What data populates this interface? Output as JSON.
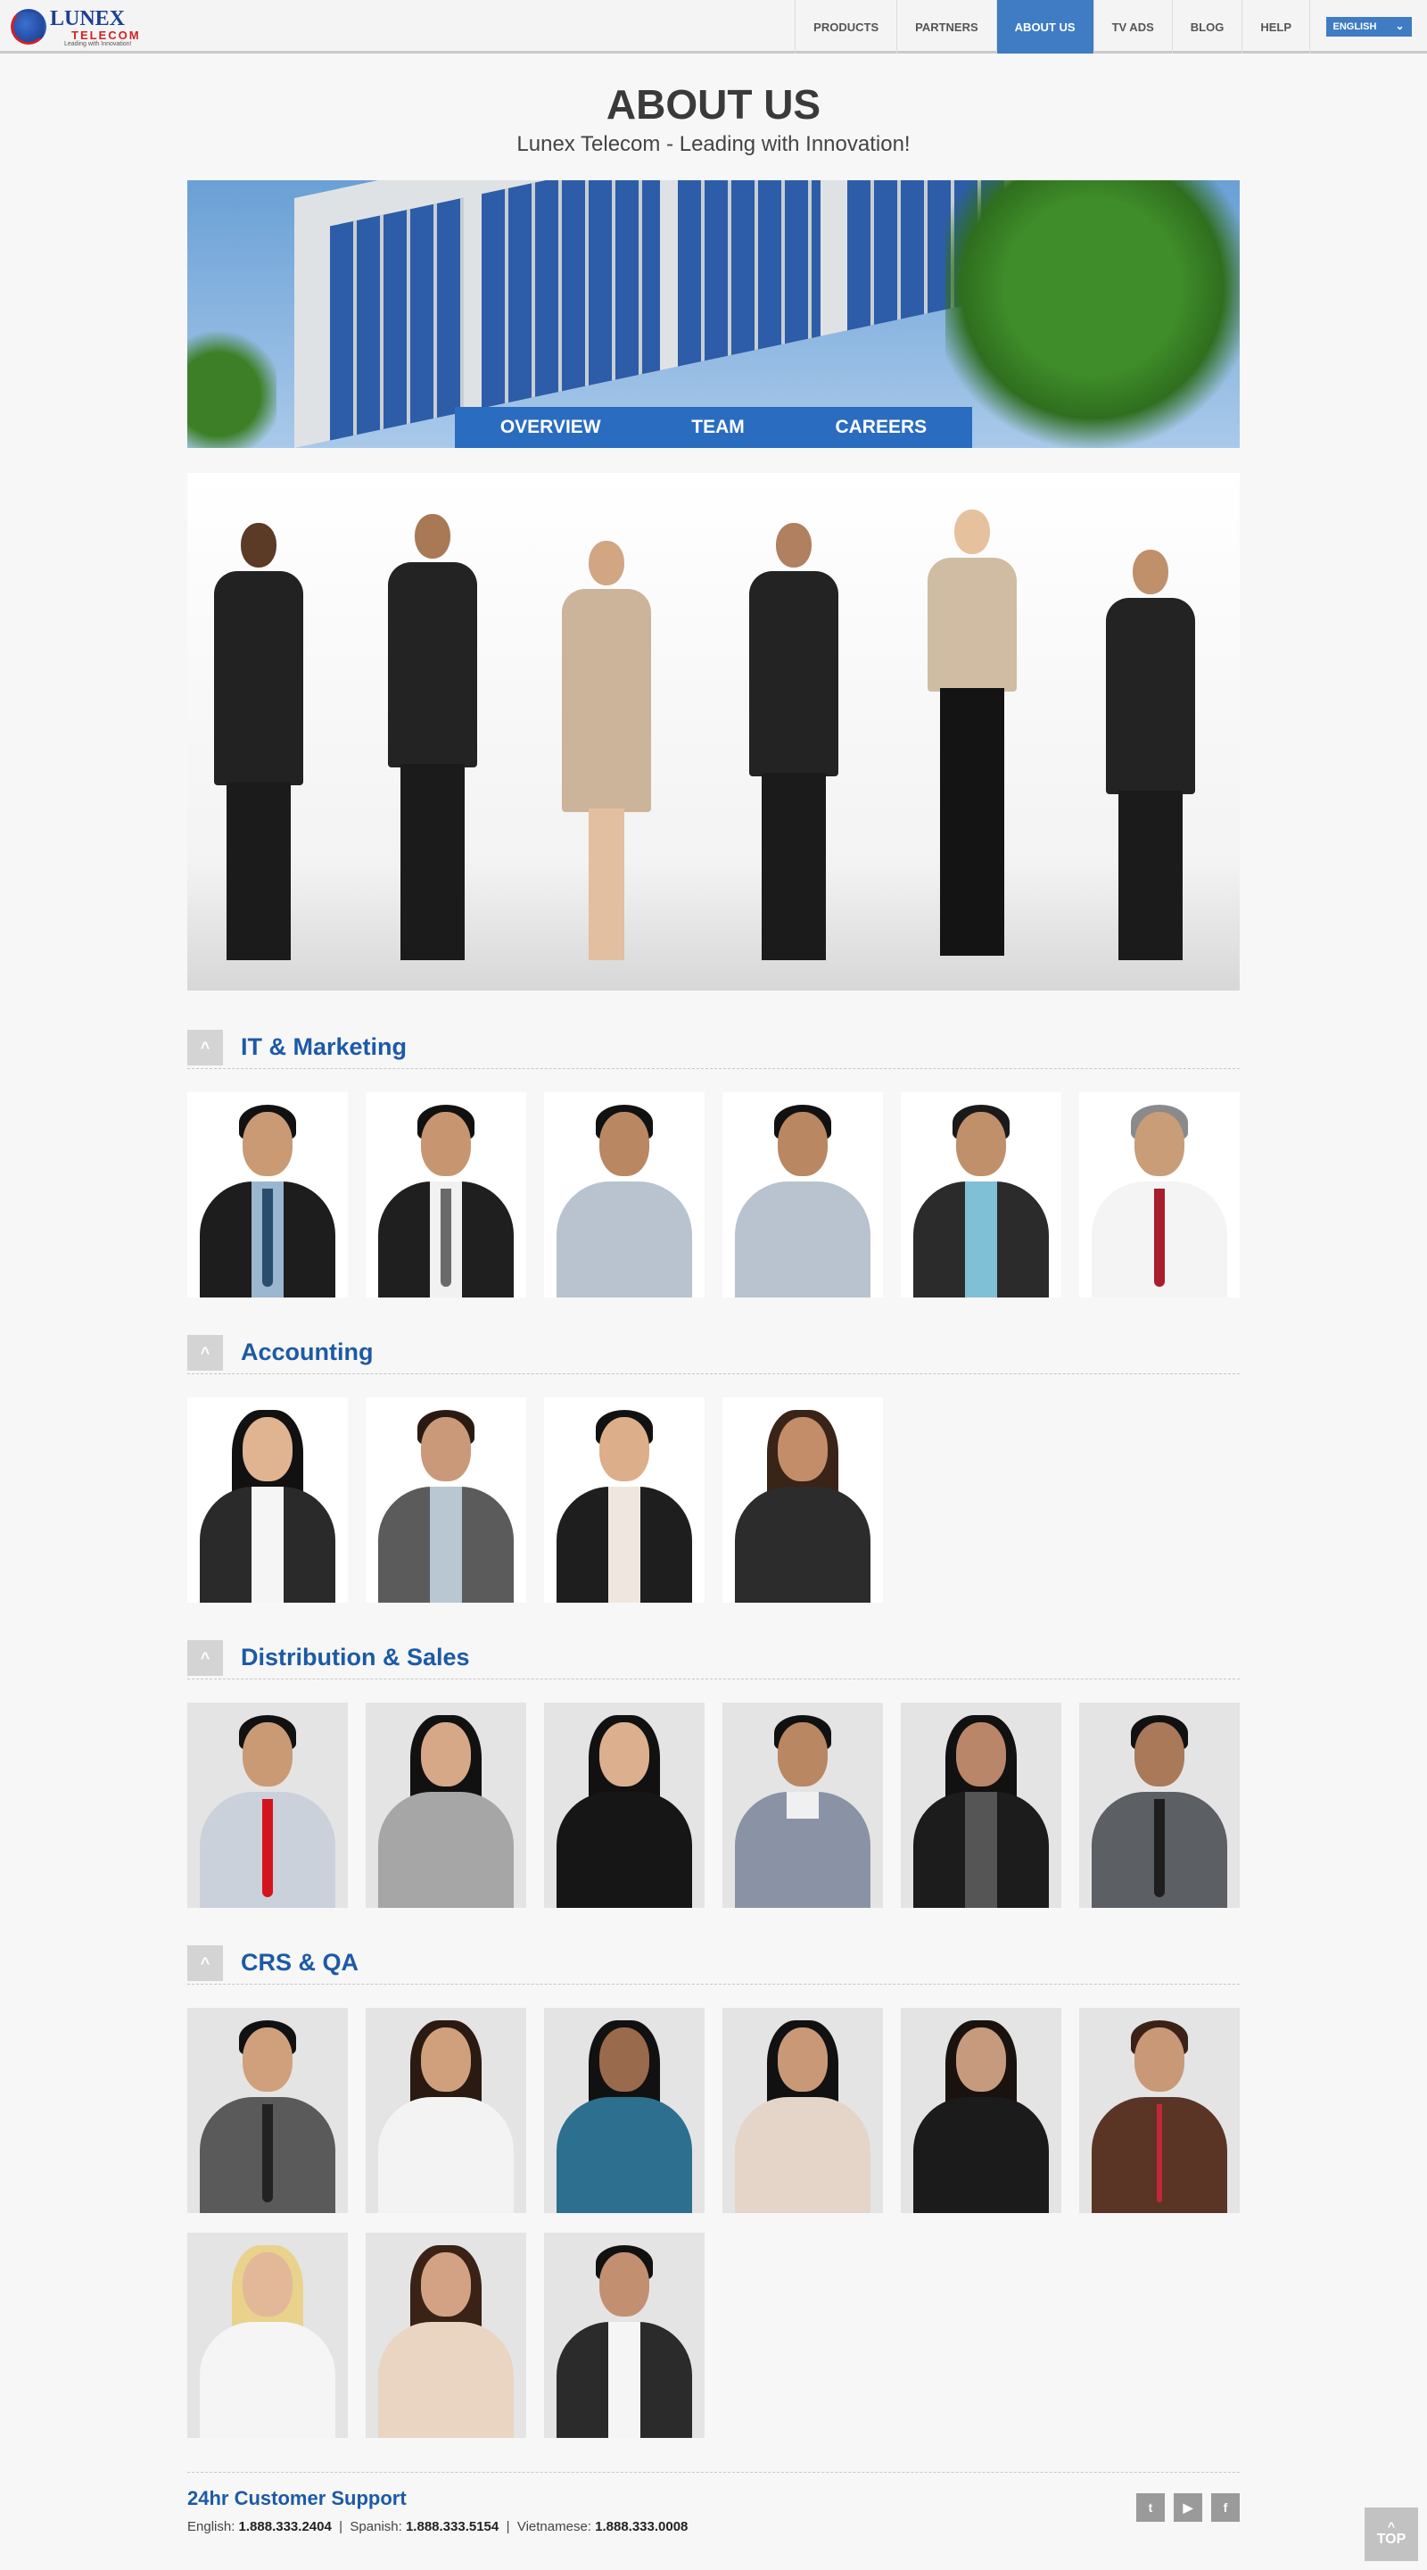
{
  "header": {
    "logo_word": "LUNEX",
    "logo_sub": "TELECOM",
    "logo_tagline": "Leading with Innovation!",
    "nav": [
      {
        "label": "PRODUCTS",
        "active": false
      },
      {
        "label": "PARTNERS",
        "active": false
      },
      {
        "label": "ABOUT US",
        "active": true
      },
      {
        "label": "TV ADS",
        "active": false
      },
      {
        "label": "BLOG",
        "active": false
      },
      {
        "label": "HELP",
        "active": false
      }
    ],
    "language": "ENGLISH"
  },
  "page": {
    "title": "ABOUT US",
    "subtitle": "Lunex Telecom - Leading with Innovation!"
  },
  "banner": {
    "tabs": [
      {
        "label": "OVERVIEW",
        "active": false
      },
      {
        "label": "TEAM",
        "active": true
      },
      {
        "label": "CAREERS",
        "active": false
      }
    ]
  },
  "sections": [
    {
      "title": "IT & Marketing",
      "toggle": "^",
      "count": 6
    },
    {
      "title": "Accounting",
      "toggle": "^",
      "count": 4
    },
    {
      "title": "Distribution & Sales",
      "toggle": "^",
      "count": 6
    },
    {
      "title": "CRS & QA",
      "toggle": "^",
      "count": 9
    }
  ],
  "footer": {
    "title": "24hr Customer Support",
    "english_label": "English:",
    "english_number": "1.888.333.2404",
    "spanish_label": "Spanish:",
    "spanish_number": "1.888.333.5154",
    "vietnamese_label": "Vietnamese:",
    "vietnamese_number": "1.888.333.0008",
    "separator": "|",
    "social": [
      {
        "icon": "twitter-icon",
        "glyph": "t"
      },
      {
        "icon": "youtube-icon",
        "glyph": "▶"
      },
      {
        "icon": "facebook-icon",
        "glyph": "f"
      }
    ],
    "top_label": "TOP",
    "top_arrow": "^"
  },
  "colors": {
    "accent": "#3f7cc3",
    "tab_bar": "#2a6cc0",
    "section_title": "#1c5aa6",
    "toggle": "#d4d4d4",
    "logo_blue": "#1d3f94",
    "logo_red": "#d32027"
  }
}
